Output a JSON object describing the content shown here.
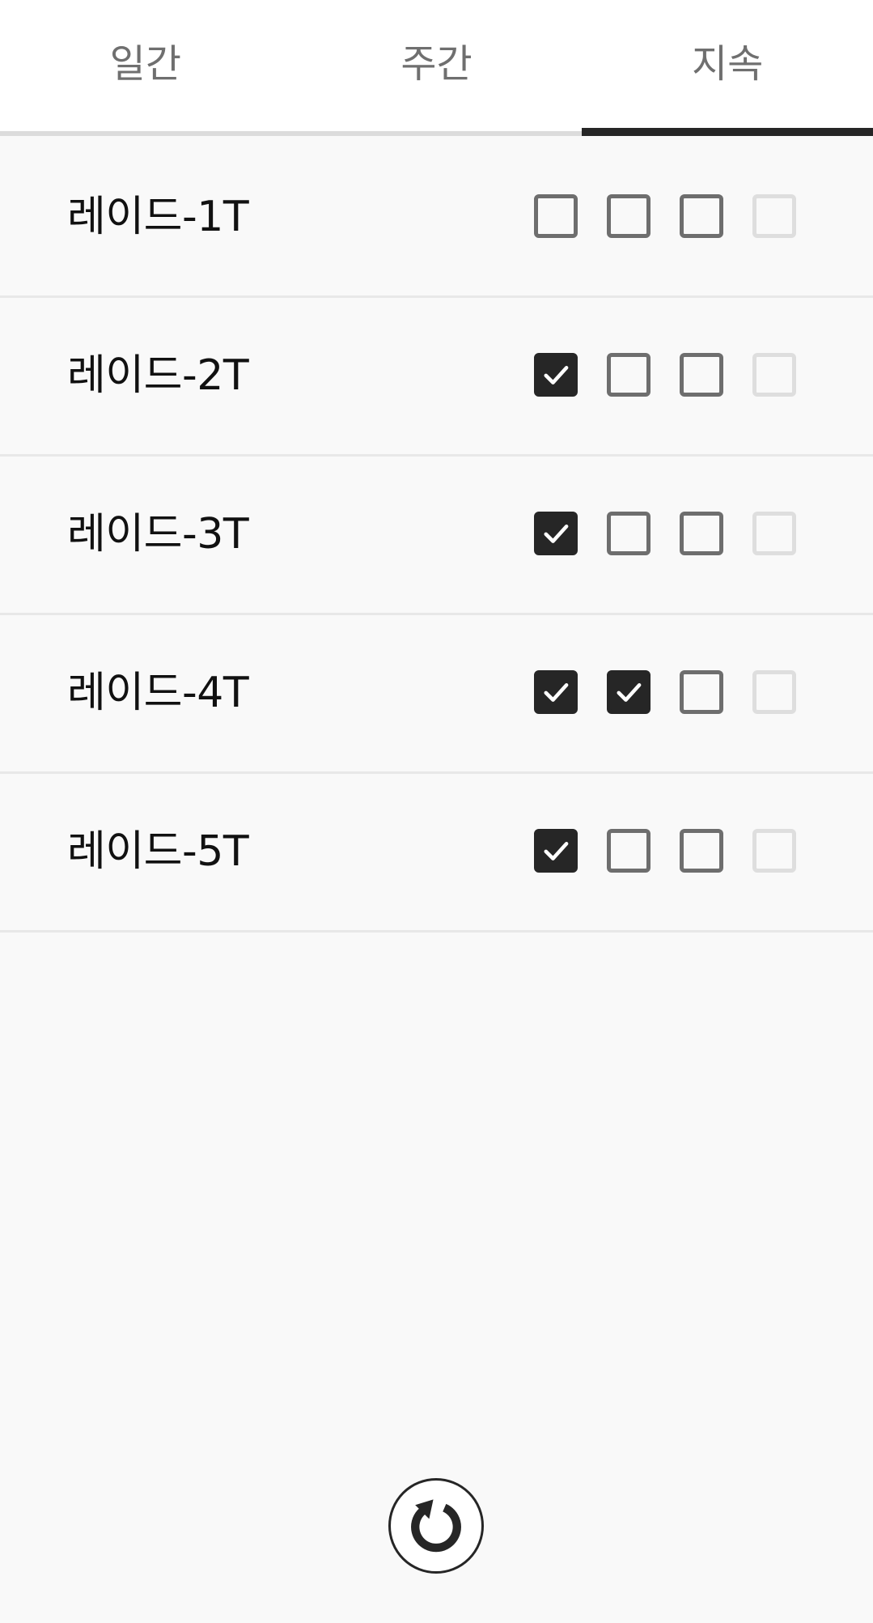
{
  "tabs": [
    {
      "label": "일간",
      "active": false
    },
    {
      "label": "주간",
      "active": false
    },
    {
      "label": "지속",
      "active": true
    }
  ],
  "tasks": [
    {
      "label": "레이드-1T",
      "checks": [
        false,
        false,
        false
      ],
      "extra_disabled": true
    },
    {
      "label": "레이드-2T",
      "checks": [
        true,
        false,
        false
      ],
      "extra_disabled": true
    },
    {
      "label": "레이드-3T",
      "checks": [
        true,
        false,
        false
      ],
      "extra_disabled": true
    },
    {
      "label": "레이드-4T",
      "checks": [
        true,
        true,
        false
      ],
      "extra_disabled": true
    },
    {
      "label": "레이드-5T",
      "checks": [
        true,
        false,
        false
      ],
      "extra_disabled": true
    }
  ],
  "refresh": {
    "icon": "refresh-icon"
  },
  "colors": {
    "accent": "#262626",
    "background": "#f9f9f9",
    "tab_text": "#6f6f6f",
    "checkbox_border": "#6e6e6e",
    "checkbox_disabled": "#dedede"
  }
}
